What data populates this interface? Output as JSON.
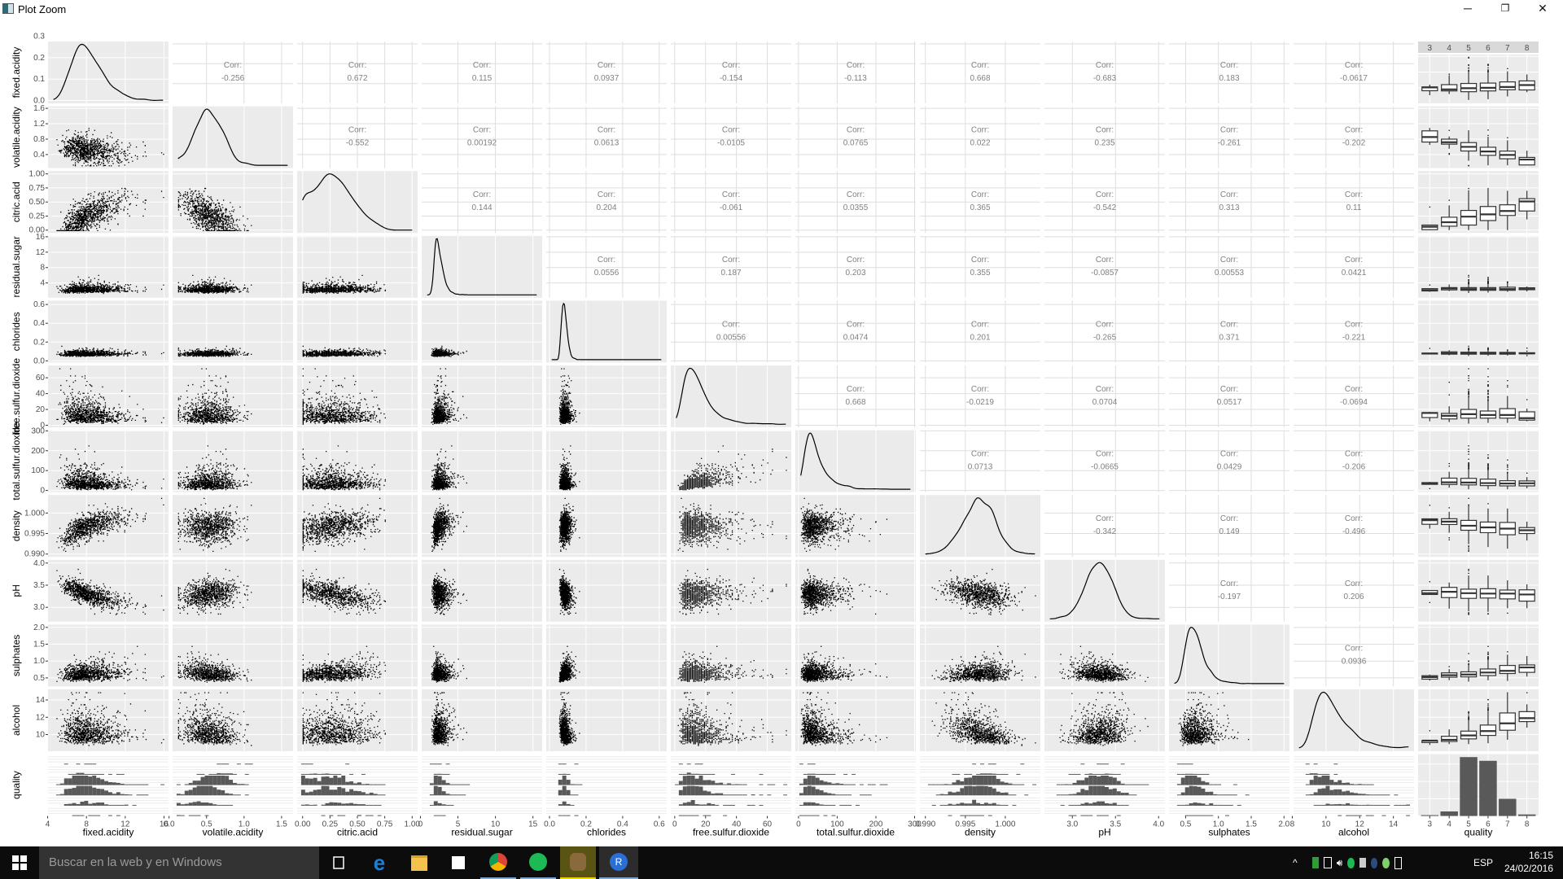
{
  "window": {
    "title": "Plot Zoom",
    "minimize": "─",
    "restore": "❐",
    "close": "✕"
  },
  "taskbar": {
    "search_placeholder": "Buscar en la web y en Windows",
    "apps": [
      "task-view",
      "edge",
      "file-explorer",
      "store",
      "chrome",
      "spotify",
      "app-gimp",
      "r"
    ],
    "language": "ESP",
    "time": "16:15",
    "date": "24/02/2016"
  },
  "chart_data": {
    "type": "scatter-matrix",
    "colors": {
      "panel_bg": "#ebebeb",
      "points": "#000000",
      "bars": "#595959",
      "corr_text": "#808080",
      "strip": "#d9d9d9"
    },
    "grid": true,
    "variables": [
      {
        "name": "fixed.acidity",
        "range": [
          4.6,
          15.9
        ],
        "ticks": [
          "4",
          "8",
          "12",
          "16"
        ],
        "tickvals": [
          4,
          8,
          12,
          16
        ]
      },
      {
        "name": "volatile.acidity",
        "range": [
          0.12,
          1.58
        ],
        "ticks": [
          "0.0",
          "0.5",
          "1.0",
          "1.5"
        ],
        "tickvals": [
          0,
          0.5,
          1,
          1.5
        ],
        "yticks": [
          "0.4",
          "0.8",
          "1.2",
          "1.6"
        ],
        "ytickvals": [
          0.4,
          0.8,
          1.2,
          1.6
        ]
      },
      {
        "name": "citric.acid",
        "range": [
          0,
          1
        ],
        "ticks": [
          "0.00",
          "0.25",
          "0.50",
          "0.75",
          "1.00"
        ],
        "tickvals": [
          0,
          0.25,
          0.5,
          0.75,
          1
        ]
      },
      {
        "name": "residual.sugar",
        "range": [
          0.9,
          15.5
        ],
        "ticks": [
          "0",
          "5",
          "10",
          "15"
        ],
        "tickvals": [
          0,
          5,
          10,
          15
        ],
        "yticks": [
          "4",
          "8",
          "12",
          "16"
        ],
        "ytickvals": [
          4,
          8,
          12,
          16
        ]
      },
      {
        "name": "chlorides",
        "range": [
          0.012,
          0.611
        ],
        "ticks": [
          "0.0",
          "0.2",
          "0.4",
          "0.6"
        ],
        "tickvals": [
          0,
          0.2,
          0.4,
          0.6
        ]
      },
      {
        "name": "free.sulfur.dioxide",
        "range": [
          1,
          72
        ],
        "ticks": [
          "0",
          "20",
          "40",
          "60"
        ],
        "tickvals": [
          0,
          20,
          40,
          60
        ]
      },
      {
        "name": "total.sulfur.dioxide",
        "range": [
          6,
          289
        ],
        "ticks": [
          "0",
          "100",
          "200",
          "300"
        ],
        "tickvals": [
          0,
          100,
          200,
          300
        ]
      },
      {
        "name": "density",
        "range": [
          0.99,
          1.0037
        ],
        "ticks": [
          "0.990",
          "0.995",
          "1.000"
        ],
        "tickvals": [
          0.99,
          0.995,
          1.0
        ]
      },
      {
        "name": "pH",
        "range": [
          2.74,
          4.01
        ],
        "ticks": [
          "3.0",
          "3.5",
          "4.0"
        ],
        "tickvals": [
          3,
          3.5,
          4
        ]
      },
      {
        "name": "sulphates",
        "range": [
          0.33,
          2.0
        ],
        "ticks": [
          "0.5",
          "1.0",
          "1.5",
          "2.0"
        ],
        "tickvals": [
          0.5,
          1,
          1.5,
          2
        ]
      },
      {
        "name": "alcohol",
        "range": [
          8.4,
          14.9
        ],
        "ticks": [
          "8",
          "10",
          "12",
          "14"
        ],
        "tickvals": [
          8,
          10,
          12,
          14
        ],
        "yticks": [
          "10",
          "12",
          "14"
        ],
        "ytickvals": [
          10,
          12,
          14
        ]
      },
      {
        "name": "quality",
        "ticks": [
          "3",
          "4",
          "5",
          "6",
          "7",
          "8"
        ]
      }
    ],
    "density_axis": {
      "ticks": [
        "0.0",
        "0.1",
        "0.2",
        "0.3"
      ],
      "tickvals": [
        0,
        0.1,
        0.2,
        0.3
      ]
    },
    "corr_label": "Corr:",
    "correlations": [
      [
        "-0.256",
        "0.672",
        "0.115",
        "0.0937",
        "-0.154",
        "-0.113",
        "0.668",
        "-0.683",
        "0.183",
        "-0.0617"
      ],
      [
        "-0.552",
        "0.00192",
        "0.0613",
        "-0.0105",
        "0.0765",
        "0.022",
        "0.235",
        "-0.261",
        "-0.202"
      ],
      [
        "0.144",
        "0.204",
        "-0.061",
        "0.0355",
        "0.365",
        "-0.542",
        "0.313",
        "0.11"
      ],
      [
        "0.0556",
        "0.187",
        "0.203",
        "0.355",
        "-0.0857",
        "0.00553",
        "0.0421"
      ],
      [
        "0.00556",
        "0.0474",
        "0.201",
        "-0.265",
        "0.371",
        "-0.221"
      ],
      [
        "0.668",
        "-0.0219",
        "0.0704",
        "0.0517",
        "-0.0694"
      ],
      [
        "0.0713",
        "-0.0665",
        "0.0429",
        "-0.206"
      ],
      [
        "-0.342",
        "0.149",
        "-0.496"
      ],
      [
        "-0.197",
        "0.206"
      ],
      [
        "0.0936"
      ]
    ],
    "quality_levels": [
      "3",
      "4",
      "5",
      "6",
      "7",
      "8"
    ],
    "quality_counts": [
      10,
      53,
      681,
      638,
      199,
      18
    ]
  }
}
